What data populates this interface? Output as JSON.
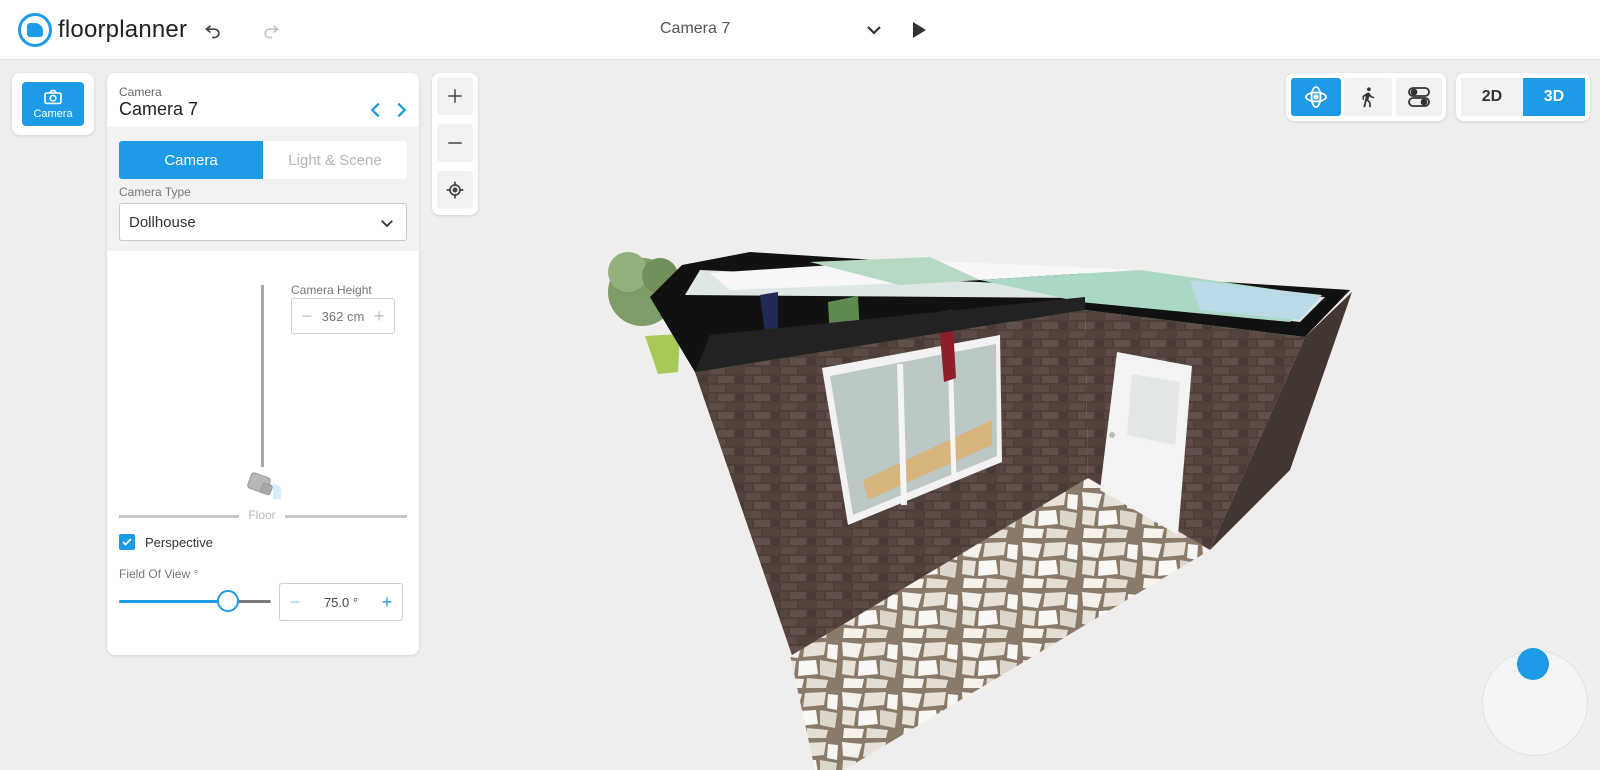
{
  "app": {
    "name": "floorplanner"
  },
  "topbar": {
    "camera_title": "Camera 7"
  },
  "tools": {
    "camera_label": "Camera"
  },
  "panel": {
    "kicker": "Camera",
    "title": "Camera 7",
    "tabs": [
      {
        "label": "Camera",
        "active": true
      },
      {
        "label": "Light & Scene",
        "active": false
      }
    ],
    "camera_type_label": "Camera Type",
    "camera_type_value": "Dollhouse",
    "camera_height_label": "Camera Height",
    "camera_height_value": "362 cm",
    "floor_label": "Floor",
    "perspective_label": "Perspective",
    "perspective_checked": true,
    "fov_label": "Field Of View °",
    "fov_value": "75.0 °",
    "fov_slider_fraction": 0.72
  },
  "view": {
    "mode_2d": "2D",
    "mode_3d": "3D",
    "active_view": "3D",
    "active_nav": "orbit"
  },
  "icons": {
    "undo": "undo-icon",
    "redo": "redo-icon",
    "chevron": "chevron-down-icon",
    "play": "play-icon",
    "camera": "camera-icon",
    "zoom_in": "plus-icon",
    "zoom_out": "minus-icon",
    "center": "crosshair-icon",
    "orbit": "orbit-icon",
    "walk": "walk-icon",
    "toggles": "toggles-icon"
  },
  "colors": {
    "accent": "#1d9be6",
    "background": "#efeeec"
  }
}
